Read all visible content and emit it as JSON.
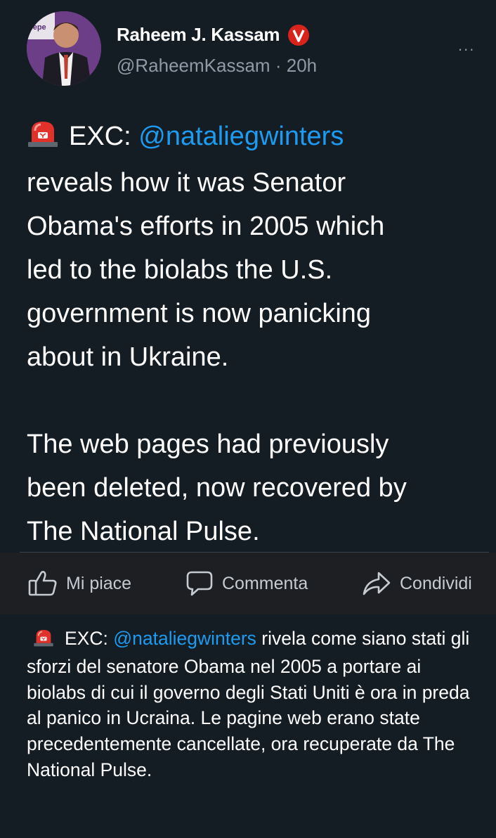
{
  "tweet": {
    "author_name": "Raheem J. Kassam",
    "verified_badge": "V",
    "handle": "@RaheemKassam",
    "separator": "·",
    "time_ago": "20h",
    "more_label": "...",
    "avatar_text": "depe",
    "body_prefix": "EXC:",
    "body_mention": "@nataliegwinters",
    "body_lines": [
      "reveals how it was Senator",
      "Obama's efforts in 2005 which",
      "led to the biolabs the U.S.",
      "government is now panicking",
      "about in Ukraine."
    ],
    "body_lines_2": [
      "The web pages had previously",
      "been deleted, now recovered by",
      "The National Pulse."
    ]
  },
  "actions": {
    "like": "Mi piace",
    "comment": "Commenta",
    "share": "Condividi"
  },
  "translation": {
    "prefix": "EXC:",
    "mention": "@nataliegwinters",
    "text": " rivela come siano stati gli sforzi del senatore Obama nel 2005 a portare ai biolabs di cui il governo degli Stati Uniti è ora in preda al panico in Ucraina. Le pagine web erano state precedentemente cancellate, ora recuperate da The National Pulse."
  },
  "colors": {
    "background": "#141c24",
    "action_bar": "#1d1f22",
    "mention": "#1d9bf0",
    "verified": "#d8241b",
    "siren": "#e0322b"
  },
  "icons": {
    "siren": "police-light-icon",
    "like": "thumbs-up-icon",
    "comment": "speech-bubble-icon",
    "share": "share-arrow-icon",
    "more": "more-dots-icon"
  }
}
